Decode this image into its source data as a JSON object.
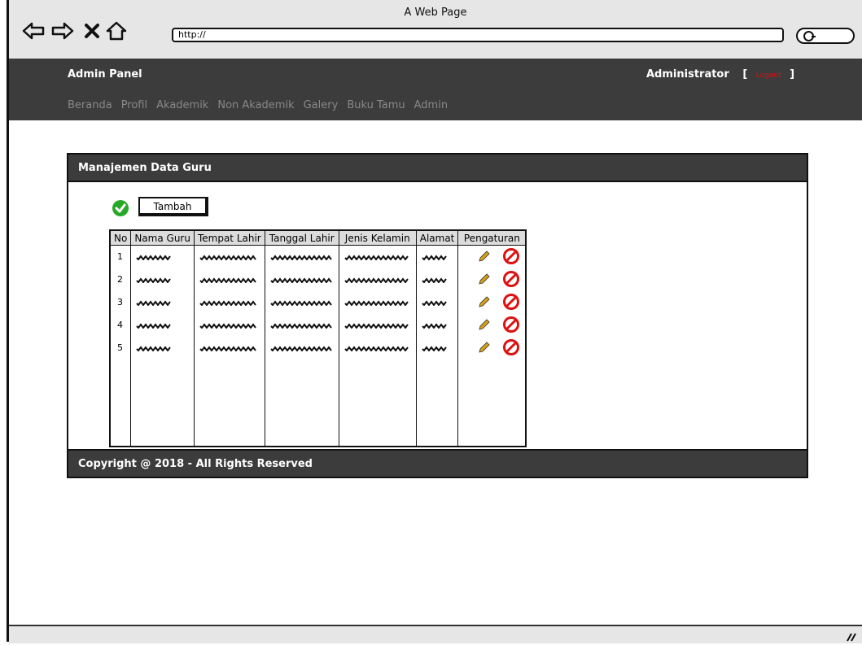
{
  "window": {
    "title": "A Web Page"
  },
  "browser": {
    "url": "http://"
  },
  "header": {
    "brand": "Admin Panel",
    "user": "Administrator",
    "bracket_open": "[",
    "logout": "Logout",
    "bracket_close": "]"
  },
  "menu": [
    "Beranda",
    "Profil",
    "Akademik",
    "Non Akademik",
    "Galery",
    "Buku Tamu",
    "Admin"
  ],
  "panel": {
    "title": "Manajemen Data Guru",
    "add_label": "Tambah",
    "footer": "Copyright @ 2018 - All Rights Reserved"
  },
  "table": {
    "columns": [
      "No",
      "Nama Guru",
      "Tempat Lahir",
      "Tanggal Lahir",
      "Jenis Kelamin",
      "Alamat",
      "Pengaturan"
    ],
    "numbers": [
      "1",
      "2",
      "3",
      "4",
      "5"
    ]
  },
  "colors": {
    "bar": "#3c3c3c",
    "accent_green": "#28a828",
    "danger": "#dd1111",
    "edit": "#d4a017"
  },
  "icons": [
    "back-arrow-icon",
    "forward-arrow-icon",
    "close-icon",
    "home-icon",
    "search-icon",
    "check-circle-icon",
    "pencil-icon",
    "no-entry-icon",
    "resize-grip-icon"
  ]
}
